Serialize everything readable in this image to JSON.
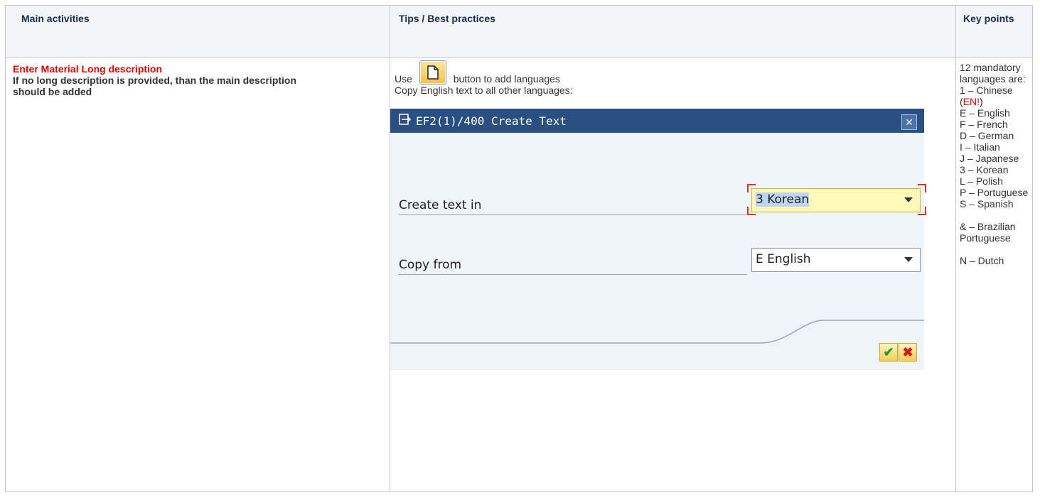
{
  "table": {
    "headers": [
      "Main activities",
      "Tips / Best practices",
      "Key points"
    ]
  },
  "main_activities": {
    "title": "Enter Material Long description",
    "note": "If no long description is provided, than the main description should be added"
  },
  "tips": {
    "use_prefix": "Use",
    "use_suffix": "button to add languages",
    "copy_line": "Copy English text to all other languages:"
  },
  "dialog": {
    "title": "EF2(1)/400 Create Text",
    "close_label": "✕",
    "fields": [
      {
        "label": "Create text in",
        "value": "3 Korean"
      },
      {
        "label": "Copy from",
        "value": "E English"
      }
    ],
    "ok_label": "✔",
    "cancel_label": "✖"
  },
  "key_points": {
    "intro": "12 mandatory languages are:",
    "chinese_prefix": "1 – Chinese (",
    "chinese_red": "EN!",
    "chinese_suffix": ")",
    "list_a": [
      "E – English",
      "F – French",
      "D – German",
      "I – Italian",
      "J – Japanese",
      "3 – Korean",
      "L – Polish",
      "P – Portuguese",
      "S – Spanish"
    ],
    "brazilian": "& – Brazilian Portuguese",
    "dutch": "N – Dutch"
  },
  "colors": {
    "accent_red": "#e00000",
    "dialog_title_bg": "#2a4f82",
    "dialog_bg": "#eff4f9",
    "focus_field_bg": "#fff8b8"
  },
  "icons": [
    "new-document-icon",
    "dialog-title-icon",
    "close-icon",
    "dropdown-arrow-icon",
    "checkmark-icon",
    "cancel-x-icon"
  ]
}
